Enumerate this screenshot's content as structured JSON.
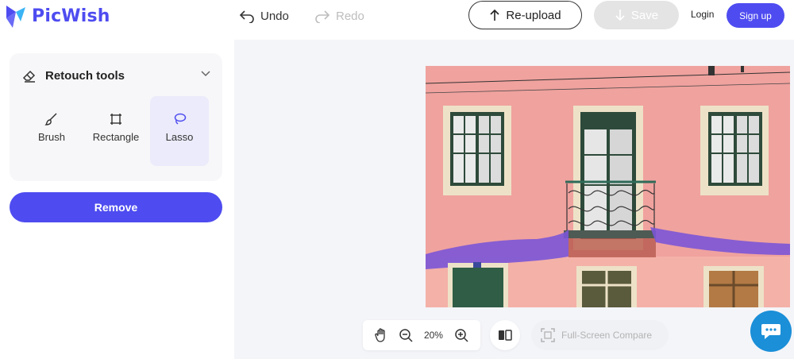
{
  "app": {
    "name": "PicWish"
  },
  "header": {
    "undo_label": "Undo",
    "redo_label": "Redo",
    "reupload_label": "Re-upload",
    "save_label": "Save",
    "login_label": "Login",
    "signup_label": "Sign up"
  },
  "sidebar": {
    "panel_title": "Retouch tools",
    "tools": [
      {
        "label": "Brush",
        "icon": "brush-icon",
        "active": false
      },
      {
        "label": "Rectangle",
        "icon": "rectangle-icon",
        "active": false
      },
      {
        "label": "Lasso",
        "icon": "lasso-icon",
        "active": true
      }
    ],
    "remove_label": "Remove"
  },
  "toolbar": {
    "zoom_value": "20%",
    "fullscreen_label": "Full-Screen Compare"
  },
  "colors": {
    "brand": "#4e4cf0",
    "selection_overlay": "#7b55d6",
    "wall": "#f1a4a0",
    "chat": "#1b8fd8"
  }
}
